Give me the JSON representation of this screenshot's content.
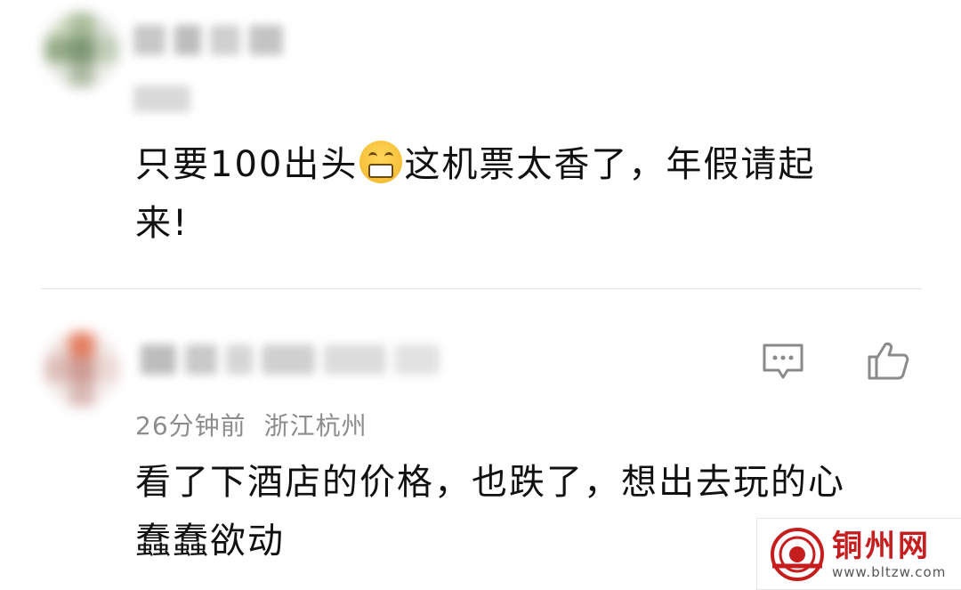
{
  "comments": [
    {
      "text_line1": "只要100出头",
      "text_after_emoji": "这机票太香了，年假请起",
      "text_line2": "来!",
      "emoji": "grinning-face-icon"
    },
    {
      "time": "26分钟前",
      "location": "浙江杭州",
      "text_line1": "看了下酒店的价格，也跌了，想出去玩的心",
      "text_line2": "蠢蠢欲动",
      "actions": {
        "reply_icon": "comment-bubble-icon",
        "like_icon": "thumbs-up-icon"
      }
    }
  ],
  "watermark": {
    "title": "铜州网",
    "url": "www.bltzw.com"
  },
  "colors": {
    "meta": "#8c8c8c",
    "divider": "#e4e4e4",
    "watermark": "#c61e1e"
  }
}
